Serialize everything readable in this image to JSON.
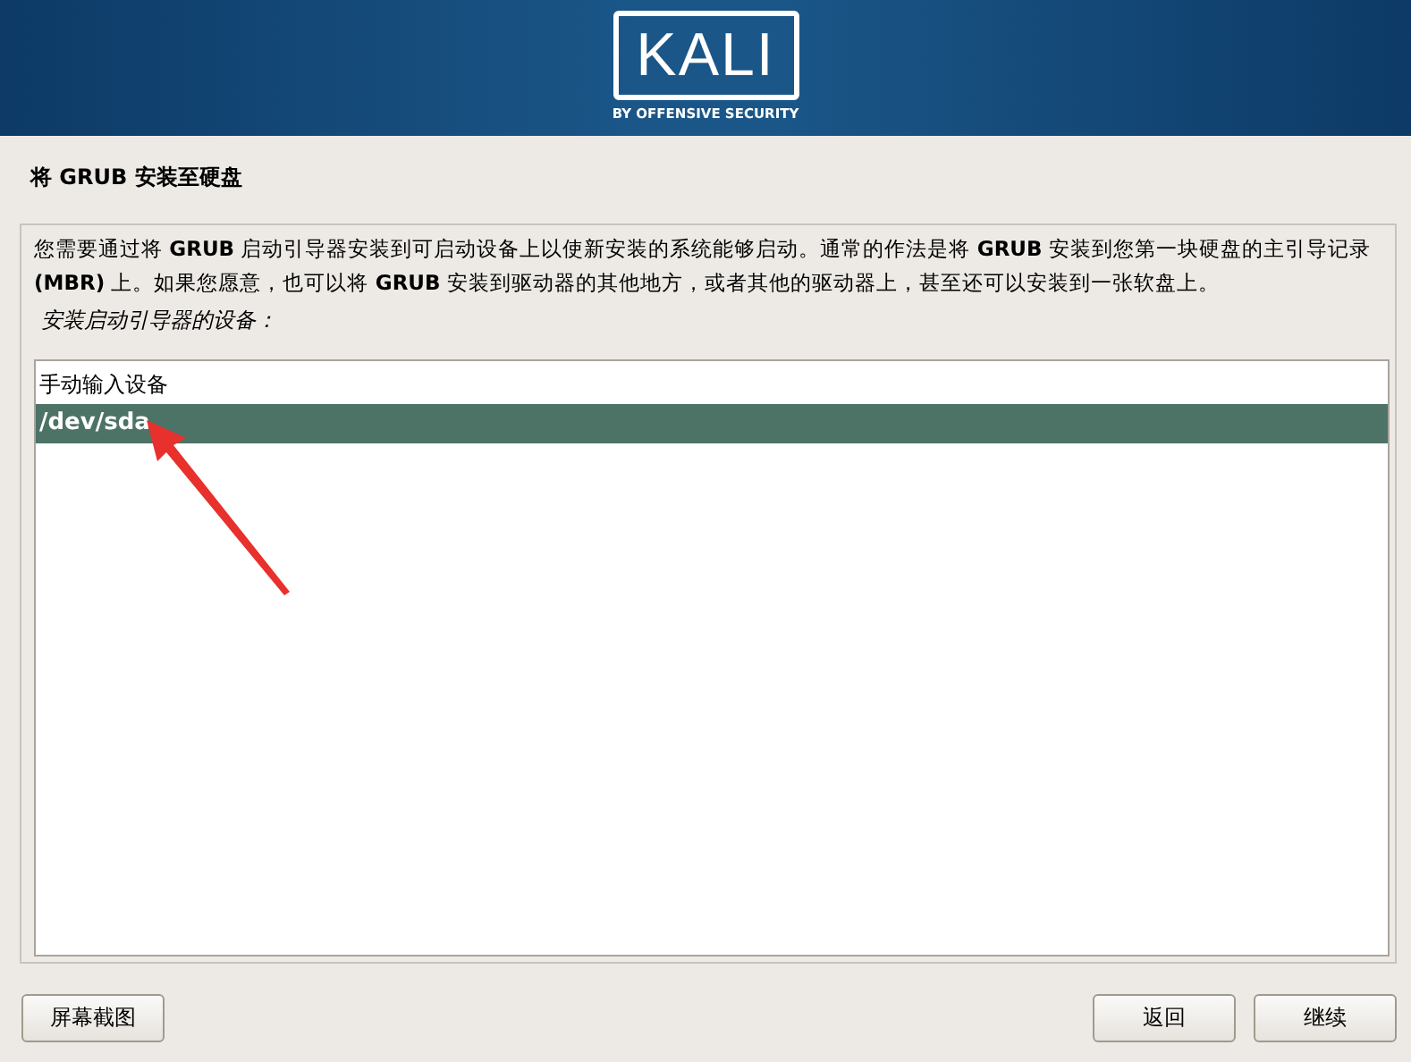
{
  "banner": {
    "logo": "KALI",
    "tagline": "BY OFFENSIVE SECURITY"
  },
  "page_title": "将 GRUB 安装至硬盘",
  "description": "您需要通过将 **GRUB** 启动引导器安装到可启动设备上以使新安装的系统能够启动。通常的作法是将 **GRUB** 安装到您第一块硬盘的主引导记录 **(MBR)** 上。如果您愿意，也可以将 **GRUB** 安装到驱动器的其他地方，或者其他的驱动器上，甚至还可以安装到一张软盘上。",
  "prompt": "安装启动引导器的设备：",
  "devices": [
    {
      "label": "手动输入设备",
      "selected": false
    },
    {
      "label": "/dev/sda",
      "selected": true
    }
  ],
  "buttons": {
    "screenshot": "屏幕截图",
    "back": "返回",
    "continue": "继续"
  }
}
